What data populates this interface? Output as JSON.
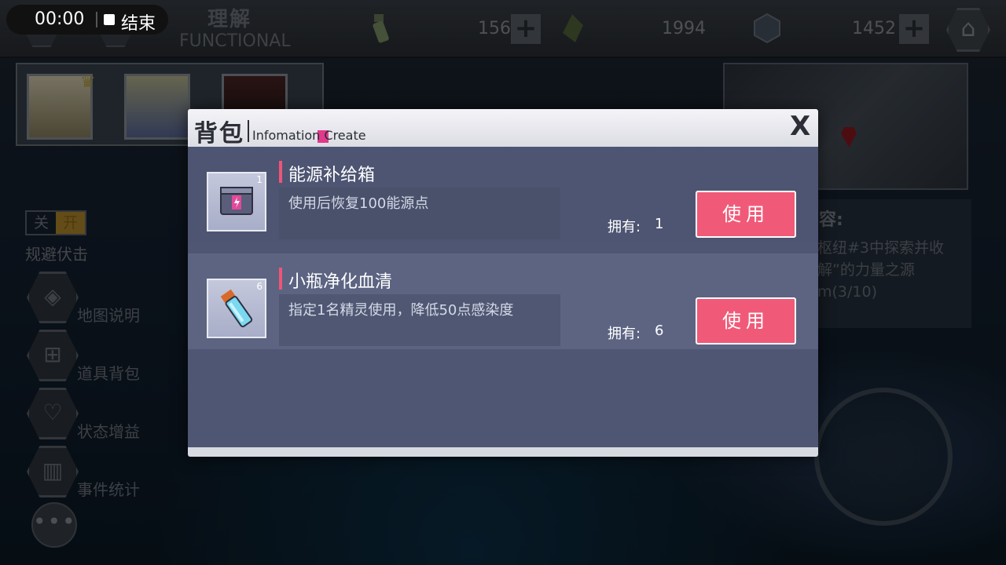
{
  "recording": {
    "time": "00:00",
    "end_label": "结束"
  },
  "header": {
    "title": "理解",
    "subtitle": "FUNCTIONAL",
    "resources": [
      {
        "icon": "potion-icon",
        "value": "156"
      },
      {
        "icon": "crystal-icon",
        "value": "1994"
      },
      {
        "icon": "cube-icon",
        "value": "1452"
      }
    ]
  },
  "mission": {
    "title_partial": "容:",
    "text": "枢纽#3中探索并收 解”的力量之源 m(3/10)"
  },
  "side_menu": {
    "toggle_off": "关",
    "toggle_on": "开",
    "ambush_label": "规避伏击",
    "items": [
      {
        "label": "地图说明",
        "icon": "map-icon"
      },
      {
        "label": "道具背包",
        "icon": "backpack-icon"
      },
      {
        "label": "状态增益",
        "icon": "heartbeat-icon"
      },
      {
        "label": "事件统计",
        "icon": "stats-icon"
      }
    ],
    "more_label": "•••"
  },
  "modal": {
    "title": "背包",
    "subtitle": "Infomation Create",
    "close_label": "X",
    "items": [
      {
        "name": "能源补给箱",
        "description": "使用后恢复100能源点",
        "own_label": "拥有:",
        "own_count": "1",
        "icon_badge": "1",
        "button_label": "使用",
        "icon": "energy-box-icon"
      },
      {
        "name": "小瓶净化血清",
        "description": "指定1名精灵使用，降低50点感染度",
        "own_label": "拥有:",
        "own_count": "6",
        "icon_badge": "6",
        "button_label": "使用",
        "icon": "serum-vial-icon"
      }
    ]
  },
  "colors": {
    "accent_pink": "#f05a78",
    "modal_bg": "#4f5673",
    "header_bg": "#f4f4f8"
  }
}
